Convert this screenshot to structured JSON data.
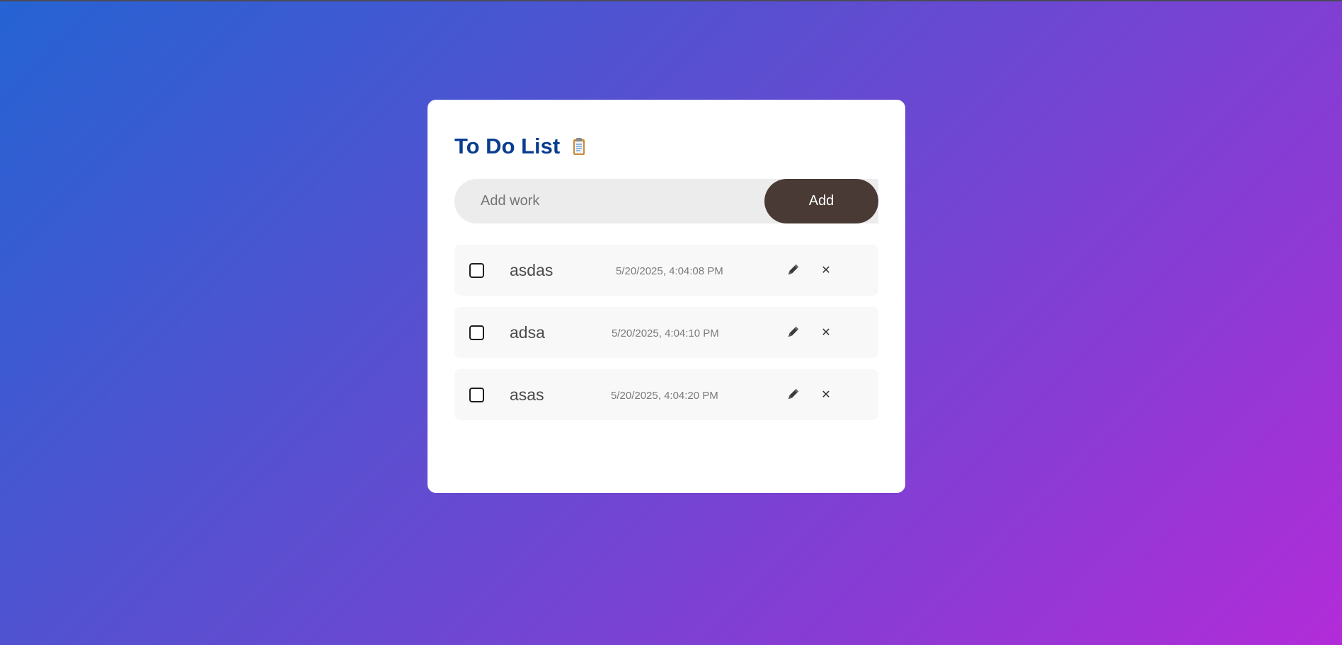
{
  "app": {
    "title": "To Do List",
    "title_icon": "clipboard-icon"
  },
  "input": {
    "value": "",
    "placeholder": "Add work"
  },
  "add_button": {
    "label": "Add"
  },
  "tasks": [
    {
      "text": "asdas",
      "time": "5/20/2025, 4:04:08 PM",
      "done": false
    },
    {
      "text": "adsa",
      "time": "5/20/2025, 4:04:10 PM",
      "done": false
    },
    {
      "text": "asas",
      "time": "5/20/2025, 4:04:20 PM",
      "done": false
    }
  ],
  "actions": {
    "edit_icon": "pencil-icon",
    "delete_icon": "close-icon",
    "delete_glyph": "✕"
  },
  "colors": {
    "title": "#0a3d8f",
    "add_button": "#4a3a36",
    "gradient_start": "#2563d3",
    "gradient_end": "#b22cd8"
  }
}
